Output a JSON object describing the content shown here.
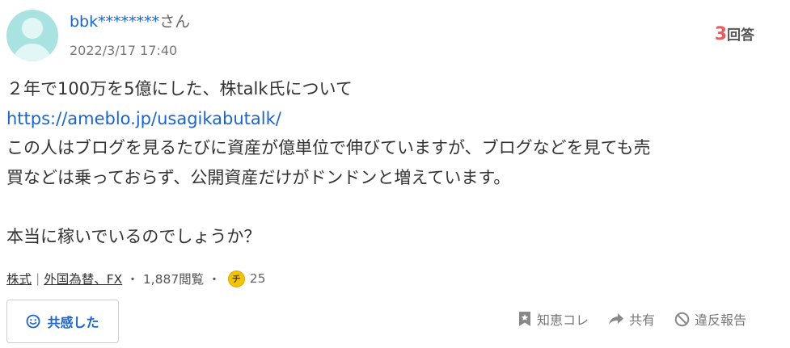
{
  "header": {
    "username": "bbk********",
    "honorific": "さん",
    "date": "2022/3/17 17:40",
    "answer_count": "3",
    "answer_label": "回答"
  },
  "question": {
    "line1": "２年で100万を5億にした、株talk氏について",
    "link": "https://ameblo.jp/usagikabutalk/",
    "line3": "この人はブログを見るたびに資産が億単位で伸びていますが、ブログなどを見ても売",
    "line4": "買などは乗っておらず、公開資産だけがドンドンと増えています。",
    "line6": "本当に稼いでいるのでしょうか？"
  },
  "meta": {
    "category1": "株式",
    "separator": "|",
    "category2": "外国為替、FX",
    "dot": "・",
    "views": "1,887閲覧",
    "coin_glyph": "チ",
    "coins": "25"
  },
  "actions": {
    "empathy_label": "共感した",
    "bookmark_label": "知恵コレ",
    "share_label": "共有",
    "report_label": "違反報告"
  },
  "colors": {
    "link": "#1864d6",
    "answer_count": "#ef5a5a",
    "avatar": "#a9e3e1",
    "coin": "#f5c400"
  },
  "icons": {
    "empathy": "smile-icon",
    "bookmark": "bookmark-star-icon",
    "share": "share-arrow-icon",
    "report": "prohibit-icon"
  }
}
